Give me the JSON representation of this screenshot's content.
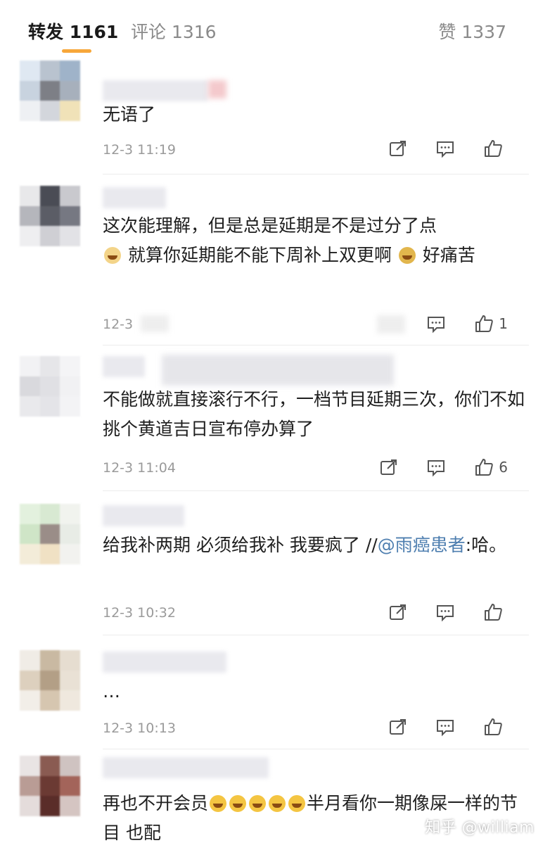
{
  "header": {
    "tabs": [
      {
        "label": "转发",
        "count": "1161"
      },
      {
        "label": "评论",
        "count": "1316"
      },
      {
        "label": "赞",
        "count": "1337"
      }
    ],
    "active_color": "#f7a73a"
  },
  "comments": [
    {
      "text": "无语了",
      "time": "12-3 11:19",
      "like_count": ""
    },
    {
      "text_parts": [
        "这次能理解，但是总是延期是不是过分了点",
        "就算你延期能不能下周补上双更啊",
        "好痛苦"
      ],
      "time": "12-3",
      "like_count": "1"
    },
    {
      "text": "不能做就直接滚行不行，一档节目延期三次，你们不如挑个黄道吉日宣布停办算了",
      "time": "12-3 11:04",
      "like_count": "6"
    },
    {
      "text": "给我补两期 必须给我补 我要疯了 //",
      "mention": "@雨癌患者",
      "text_after": ":哈。",
      "time": "12-3 10:32",
      "like_count": ""
    },
    {
      "text": "…",
      "time": "12-3 10:13",
      "like_count": ""
    },
    {
      "text_before": "再也不开会员",
      "text_after": "半月看你一期像屎一样的节目 也配",
      "time": "",
      "like_count": ""
    }
  ],
  "watermark": "知乎 @william",
  "icons": {
    "forward": "forward-icon",
    "comment": "comment-icon",
    "like": "like-icon",
    "emoji": "emoji-icon"
  }
}
